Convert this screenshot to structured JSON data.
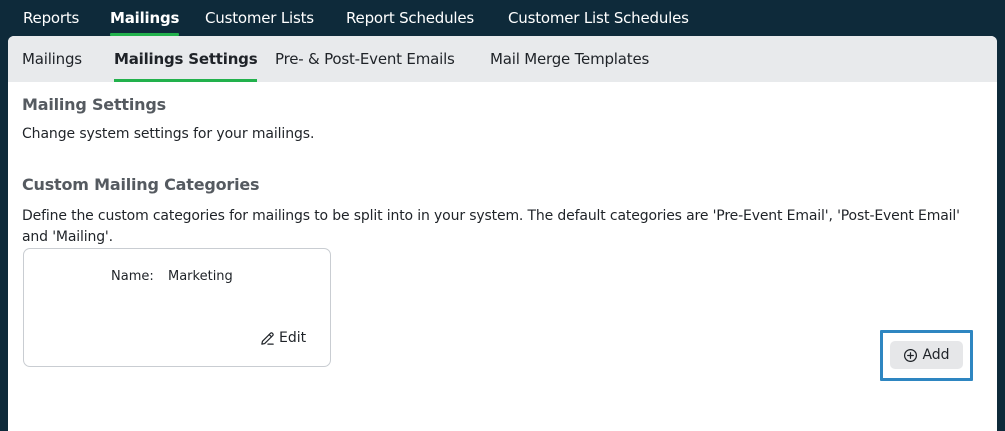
{
  "top_nav": {
    "tabs": [
      {
        "label": "Reports",
        "active": false
      },
      {
        "label": "Mailings",
        "active": true
      },
      {
        "label": "Customer Lists",
        "active": false
      },
      {
        "label": "Report Schedules",
        "active": false
      },
      {
        "label": "Customer List Schedules",
        "active": false
      }
    ]
  },
  "sub_nav": {
    "tabs": [
      {
        "label": "Mailings",
        "active": false
      },
      {
        "label": "Mailings Settings",
        "active": true
      },
      {
        "label": "Pre- & Post-Event Emails",
        "active": false
      },
      {
        "label": "Mail Merge Templates",
        "active": false
      }
    ]
  },
  "mailing_settings": {
    "title": "Mailing Settings",
    "description": "Change system settings for your mailings."
  },
  "custom_categories": {
    "title": "Custom Mailing Categories",
    "description": "Define the custom categories for mailings to be split into in your system. The default categories are 'Pre-Event Email', 'Post-Event Email' and 'Mailing'.",
    "items": [
      {
        "name_label": "Name:",
        "name_value": "Marketing",
        "edit_label": "Edit",
        "edit_icon": "pencil-icon"
      }
    ],
    "add_label": "Add",
    "add_icon": "plus-circle-icon"
  },
  "colors": {
    "background": "#0e2a3a",
    "accent": "#22b14c",
    "highlight": "#2e86c1"
  }
}
